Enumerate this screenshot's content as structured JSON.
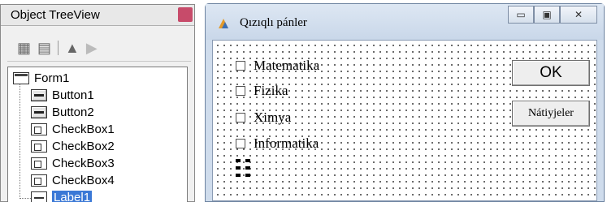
{
  "tree_panel": {
    "title": "Object TreeView",
    "toolbar_icons": [
      "object-inspector-icon",
      "form-icon",
      "up-arrow-icon",
      "down-arrow-icon"
    ],
    "nodes": [
      {
        "label": "Form1",
        "type": "form"
      },
      {
        "label": "Button1",
        "type": "button"
      },
      {
        "label": "Button2",
        "type": "button"
      },
      {
        "label": "CheckBox1",
        "type": "checkbox"
      },
      {
        "label": "CheckBox2",
        "type": "checkbox"
      },
      {
        "label": "CheckBox3",
        "type": "checkbox"
      },
      {
        "label": "CheckBox4",
        "type": "checkbox"
      },
      {
        "label": "Label1",
        "type": "label",
        "selected": true
      }
    ]
  },
  "form_window": {
    "title": "Qızıqlı pánler",
    "caption_buttons": {
      "minimize": "minimize-icon",
      "maximize": "maximize-icon",
      "close": "close-icon"
    },
    "checkboxes": [
      "Matematika",
      "Fizika",
      "Ximya",
      "Informatika"
    ],
    "ok_button": "OK",
    "results_button": "Nátiyjeler"
  },
  "colors": {
    "selection": "#3a78d6",
    "window_frame": "#cfdcec",
    "form_dots": "#3a3a3a"
  }
}
